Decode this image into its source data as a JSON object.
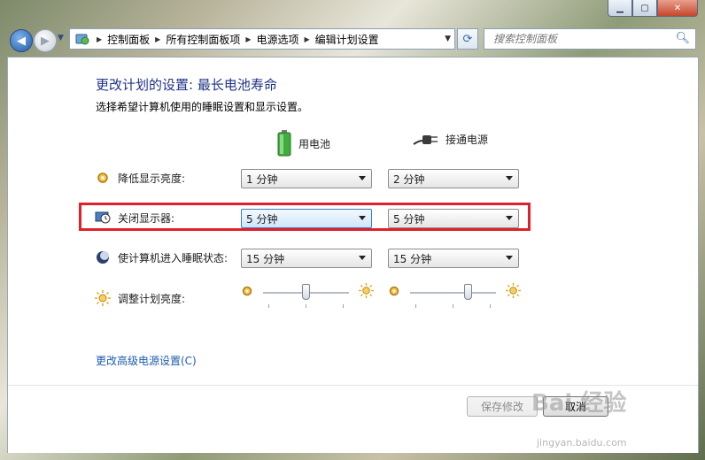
{
  "window": {
    "minimize_icon": "minimize-icon",
    "maximize_icon": "maximize-icon",
    "close_icon": "close-icon"
  },
  "nav": {
    "breadcrumbs": [
      "控制面板",
      "所有控制面板项",
      "电源选项",
      "编辑计划设置"
    ],
    "search_placeholder": "搜索控制面板"
  },
  "page": {
    "title": "更改计划的设置: 最长电池寿命",
    "subtitle": "选择希望计算机使用的睡眠设置和显示设置。",
    "columns": {
      "battery": "用电池",
      "plugged": "接通电源"
    }
  },
  "settings": {
    "dim_display": {
      "label": "降低显示亮度:",
      "battery": "1 分钟",
      "plugged": "2 分钟"
    },
    "turn_off_display": {
      "label": "关闭显示器:",
      "battery": "5 分钟",
      "plugged": "5 分钟"
    },
    "sleep": {
      "label": "使计算机进入睡眠状态:",
      "battery": "15 分钟",
      "plugged": "15 分钟"
    },
    "brightness": {
      "label": "调整计划亮度:",
      "battery_level": 0.5,
      "plugged_level": 0.68
    }
  },
  "advanced_link": "更改高级电源设置(C)",
  "buttons": {
    "save": "保存修改",
    "cancel": "取消"
  },
  "watermark": {
    "text": "Bai 经验",
    "url": "jingyan.baidu.com"
  },
  "colors": {
    "title": "#1e3287",
    "link": "#1e5bb0",
    "highlight": "#e0202a"
  }
}
